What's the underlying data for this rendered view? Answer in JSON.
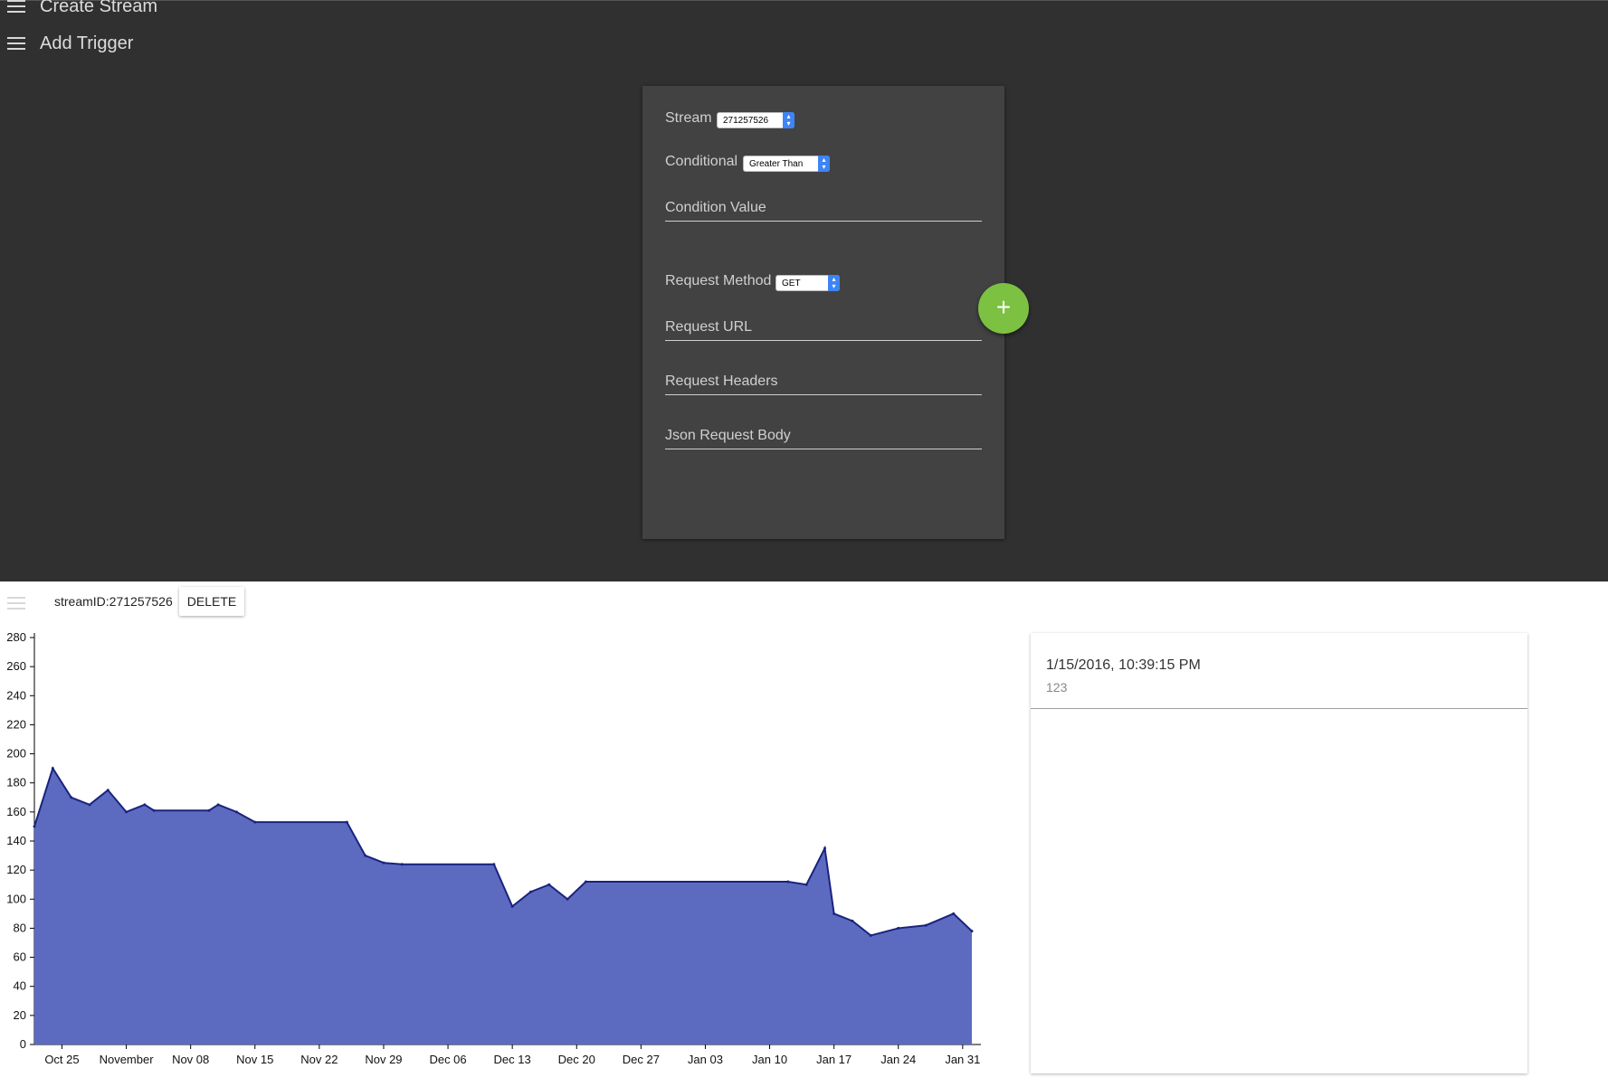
{
  "nav": {
    "items": [
      {
        "label": "Create Stream"
      },
      {
        "label": "Add Trigger"
      }
    ]
  },
  "form": {
    "stream_label": "Stream",
    "stream_value": "271257526",
    "conditional_label": "Conditional",
    "conditional_value": "Greater Than",
    "condition_value_placeholder": "Condition Value",
    "request_method_label": "Request Method",
    "request_method_value": "GET",
    "request_url_placeholder": "Request URL",
    "request_headers_placeholder": "Request Headers",
    "json_body_placeholder": "Json Request Body",
    "add_button_label": "+"
  },
  "colors": {
    "accent_fab": "#7cc142",
    "chart_fill": "#5c6bc0",
    "chart_line": "#1a237e"
  },
  "stream": {
    "id_label": "streamID:271257526",
    "delete_label": "DELETE"
  },
  "panel": {
    "timestamp": "1/15/2016, 10:39:15 PM",
    "value": "123"
  },
  "chart_data": {
    "type": "area",
    "title": "",
    "xlabel": "",
    "ylabel": "",
    "ylim": [
      0,
      280
    ],
    "yticks": [
      0,
      20,
      40,
      60,
      80,
      100,
      120,
      140,
      160,
      180,
      200,
      220,
      240,
      260,
      280
    ],
    "xticks": [
      "Oct 25",
      "November",
      "Nov 08",
      "Nov 15",
      "Nov 22",
      "Nov 29",
      "Dec 06",
      "Dec 13",
      "Dec 20",
      "Dec 27",
      "Jan 03",
      "Jan 10",
      "Jan 17",
      "Jan 24",
      "Jan 31"
    ],
    "x": [
      "2015-10-22",
      "2015-10-24",
      "2015-10-26",
      "2015-10-28",
      "2015-10-30",
      "2015-11-01",
      "2015-11-03",
      "2015-11-04",
      "2015-11-10",
      "2015-11-11",
      "2015-11-13",
      "2015-11-15",
      "2015-11-25",
      "2015-11-27",
      "2015-11-29",
      "2015-12-01",
      "2015-12-11",
      "2015-12-13",
      "2015-12-15",
      "2015-12-17",
      "2015-12-19",
      "2015-12-21",
      "2016-01-12",
      "2016-01-14",
      "2016-01-16",
      "2016-01-17",
      "2016-01-19",
      "2016-01-21",
      "2016-01-24",
      "2016-01-27",
      "2016-01-30",
      "2016-02-01"
    ],
    "series": [
      {
        "values": [
          150,
          190,
          170,
          165,
          175,
          160,
          165,
          161,
          161,
          165,
          160,
          153,
          153,
          130,
          125,
          124,
          124,
          95,
          105,
          110,
          100,
          112,
          112,
          110,
          135,
          90,
          85,
          75,
          80,
          82,
          90,
          78
        ]
      }
    ]
  }
}
